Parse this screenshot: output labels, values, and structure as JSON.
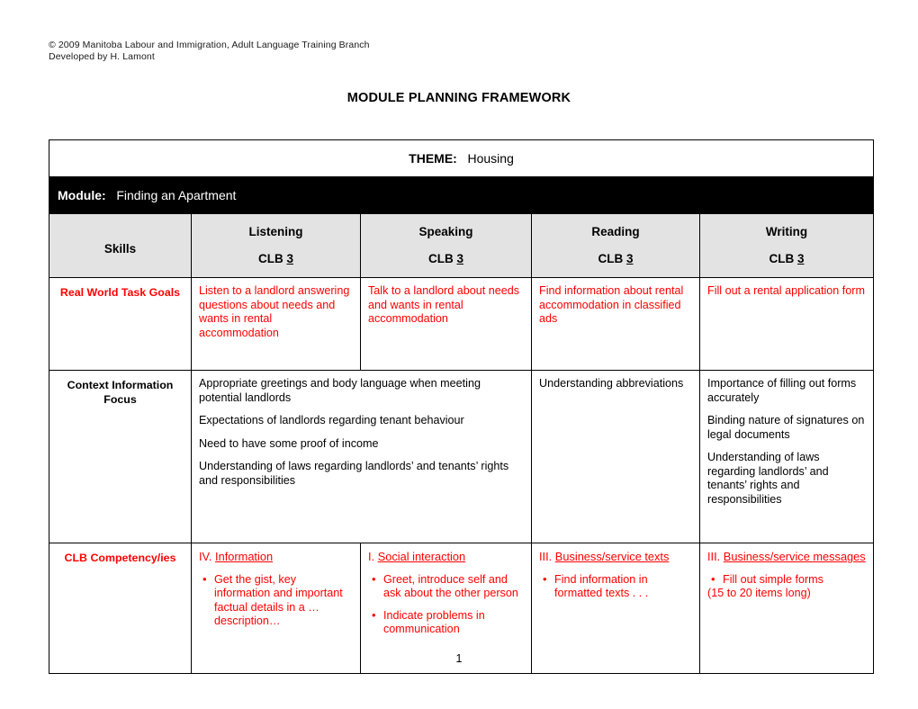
{
  "header": {
    "copyright": "© 2009 Manitoba Labour and Immigration, Adult Language Training Branch",
    "developed_by": "Developed by H. Lamont"
  },
  "title": "MODULE PLANNING FRAMEWORK",
  "page_number": "1",
  "colors": {
    "accent_red": "#ff0000",
    "module_band": "#000000",
    "header_row": "#e3e3e3",
    "text": "#000000"
  },
  "table": {
    "theme": {
      "label": "THEME:",
      "value": "Housing"
    },
    "module": {
      "label": "Module:",
      "value": "Finding an Apartment"
    },
    "skills_header": {
      "row_label": "Skills",
      "clb_prefix": "CLB ",
      "columns": [
        {
          "skill": "Listening",
          "clb_level": "3"
        },
        {
          "skill": "Speaking",
          "clb_level": "3"
        },
        {
          "skill": "Reading",
          "clb_level": "3"
        },
        {
          "skill": "Writing",
          "clb_level": "3"
        }
      ]
    },
    "rows": [
      {
        "label": "Real World Task Goals",
        "listening": "Listen to a landlord answering questions about needs and wants in rental accommodation",
        "speaking": "Talk to a landlord about needs and wants in rental accommodation",
        "reading": "Find information about rental accommodation in classified ads",
        "writing": "Fill out a rental application form"
      },
      {
        "label": "Context Information Focus",
        "listening_speaking": [
          "Appropriate greetings and body language when meeting potential landlords",
          "Expectations of landlords regarding tenant behaviour",
          "Need to have some proof of income",
          "Understanding of laws regarding landlords’ and tenants’ rights and responsibilities"
        ],
        "reading": [
          "Understanding abbreviations"
        ],
        "writing": [
          "Importance of filling out forms accurately",
          "Binding nature of signatures on legal documents",
          "Understanding of laws regarding landlords’ and tenants’ rights and responsibilities"
        ]
      },
      {
        "label": "CLB Competency/ies",
        "listening": {
          "numeral": "IV.",
          "heading": "Information",
          "bullets": [
            "Get the gist, key information and important factual details in a …description…"
          ],
          "note": ""
        },
        "speaking": {
          "numeral": "I.",
          "heading": "Social interaction",
          "bullets": [
            "Greet, introduce self and ask about the other person",
            "Indicate problems in communication"
          ],
          "note": ""
        },
        "reading": {
          "numeral": "III.",
          "heading": "Business/service texts",
          "bullets": [
            "Find information in formatted texts . . ."
          ],
          "note": ""
        },
        "writing": {
          "numeral": "III.",
          "heading": "Business/service messages",
          "bullets": [
            "Fill out simple forms"
          ],
          "note": "(15 to 20 items long)"
        }
      }
    ]
  }
}
